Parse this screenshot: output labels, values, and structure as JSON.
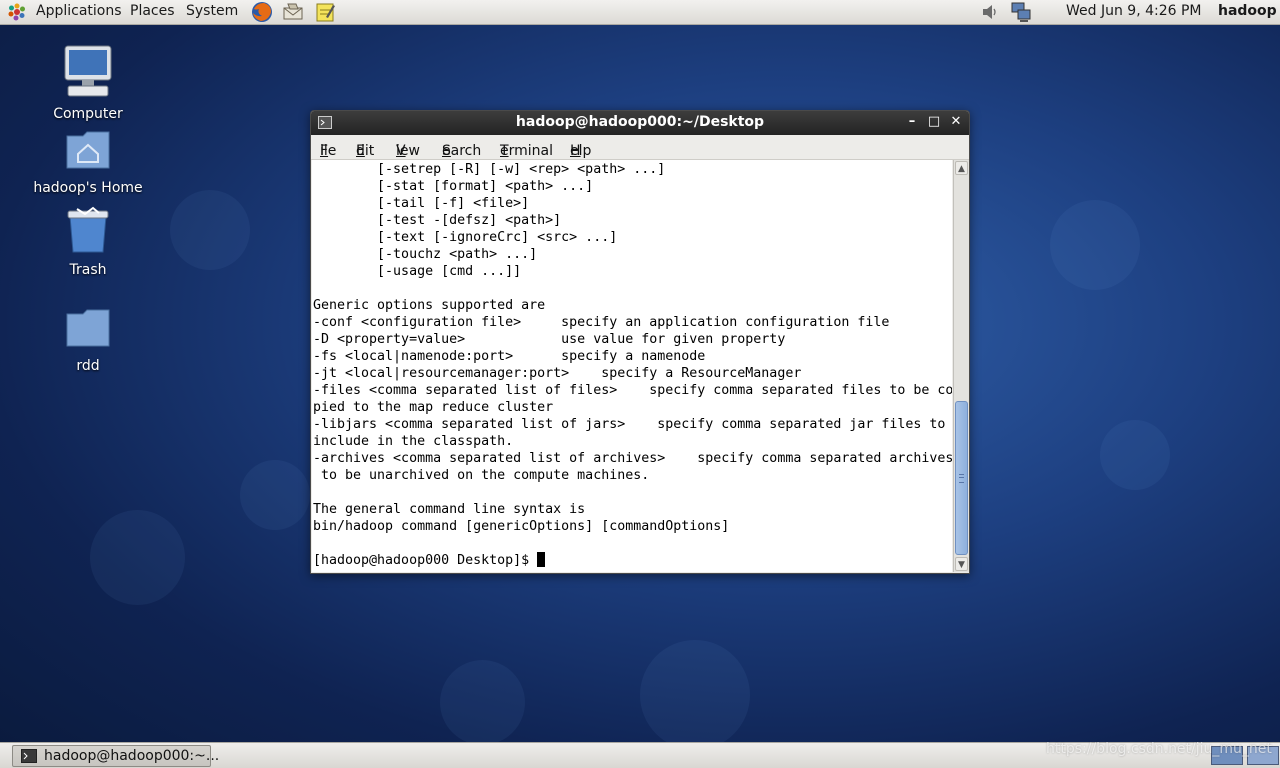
{
  "top_panel": {
    "menus": [
      "Applications",
      "Places",
      "System"
    ],
    "launchers": [
      "firefox-icon",
      "mail-icon",
      "notes-icon"
    ],
    "clock": "Wed Jun  9,  4:26 PM",
    "user": "hadoop"
  },
  "desktop": {
    "icons": [
      {
        "label": "Computer"
      },
      {
        "label": "hadoop's Home"
      },
      {
        "label": "Trash"
      },
      {
        "label": "rdd"
      }
    ]
  },
  "terminal": {
    "title": "hadoop@hadoop000:~/Desktop",
    "menus": [
      {
        "mnemonic": "F",
        "rest": "ile"
      },
      {
        "mnemonic": "E",
        "rest": "dit"
      },
      {
        "mnemonic": "V",
        "rest": "iew"
      },
      {
        "mnemonic": "S",
        "rest": "earch"
      },
      {
        "mnemonic": "T",
        "rest": "erminal"
      },
      {
        "mnemonic": "H",
        "rest": "elp"
      }
    ],
    "lines": [
      "        [-setrep [-R] [-w] <rep> <path> ...]",
      "        [-stat [format] <path> ...]",
      "        [-tail [-f] <file>]",
      "        [-test -[defsz] <path>]",
      "        [-text [-ignoreCrc] <src> ...]",
      "        [-touchz <path> ...]",
      "        [-usage [cmd ...]]",
      "",
      "Generic options supported are",
      "-conf <configuration file>     specify an application configuration file",
      "-D <property=value>            use value for given property",
      "-fs <local|namenode:port>      specify a namenode",
      "-jt <local|resourcemanager:port>    specify a ResourceManager",
      "-files <comma separated list of files>    specify comma separated files to be co",
      "pied to the map reduce cluster",
      "-libjars <comma separated list of jars>    specify comma separated jar files to ",
      "include in the classpath.",
      "-archives <comma separated list of archives>    specify comma separated archives",
      " to be unarchived on the compute machines.",
      "",
      "The general command line syntax is",
      "bin/hadoop command [genericOptions] [commandOptions]",
      ""
    ],
    "prompt": "[hadoop@hadoop000 Desktop]$ ",
    "scroll_position": 0.98
  },
  "bottom_panel": {
    "task_label": "hadoop@hadoop000:~...",
    "watermark": "https://blog.csdn.net/jiu_mu_net"
  }
}
